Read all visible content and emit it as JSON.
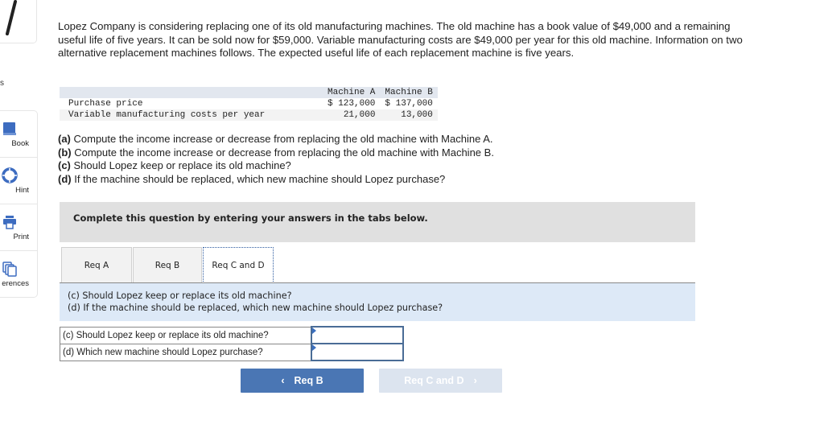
{
  "sidebar": {
    "partial_label": "s",
    "items": [
      {
        "label": "Book",
        "icon": "book-icon"
      },
      {
        "label": "Hint",
        "icon": "lifebuoy-icon"
      },
      {
        "label": "Print",
        "icon": "printer-icon"
      },
      {
        "label": "erences",
        "icon": "copies-icon"
      }
    ]
  },
  "intro": "Lopez Company is considering replacing one of its old manufacturing machines. The old machine has a book value of $49,000 and a remaining useful life of five years. It can be sold now for $59,000. Variable manufacturing costs are $49,000 per year for this old machine. Information on two alternative replacement machines follows. The expected useful life of each replacement machine is five years.",
  "machines_table": {
    "headers": [
      "",
      "Machine A",
      "Machine B"
    ],
    "rows": [
      {
        "label": "Purchase price",
        "a": "$ 123,000",
        "b": "$ 137,000"
      },
      {
        "label": "Variable manufacturing costs per year",
        "a": "21,000",
        "b": "13,000"
      }
    ]
  },
  "questions": [
    {
      "tag": "(a)",
      "text": " Compute the income increase or decrease from replacing the old machine with Machine A."
    },
    {
      "tag": "(b)",
      "text": " Compute the income increase or decrease from replacing the old machine with Machine B."
    },
    {
      "tag": "(c)",
      "text": " Should Lopez keep or replace its old machine?"
    },
    {
      "tag": "(d)",
      "text": " If the machine should be replaced, which new machine should Lopez purchase?"
    }
  ],
  "instruction": "Complete this question by entering your answers in the tabs below.",
  "tabs": [
    {
      "label": "Req A",
      "active": false
    },
    {
      "label": "Req B",
      "active": false
    },
    {
      "label": "Req C and D",
      "active": true
    }
  ],
  "panel": {
    "line1": "(c) Should Lopez keep or replace its old machine?",
    "line2": "(d) If the machine should be replaced, which new machine should Lopez purchase?"
  },
  "answers": [
    {
      "question": "(c) Should Lopez keep or replace its old machine?",
      "value": ""
    },
    {
      "question": "(d) Which new machine should Lopez purchase?",
      "value": ""
    }
  ],
  "nav": {
    "prev_label": "Req B",
    "prev_icon": "‹",
    "next_label": "Req C and D",
    "next_icon": "›"
  },
  "colors": {
    "accent": "#4a76b4",
    "disabled": "#dce4ef",
    "panel_bg": "#dde9f7",
    "instruction_bg": "#e0e0e0"
  }
}
